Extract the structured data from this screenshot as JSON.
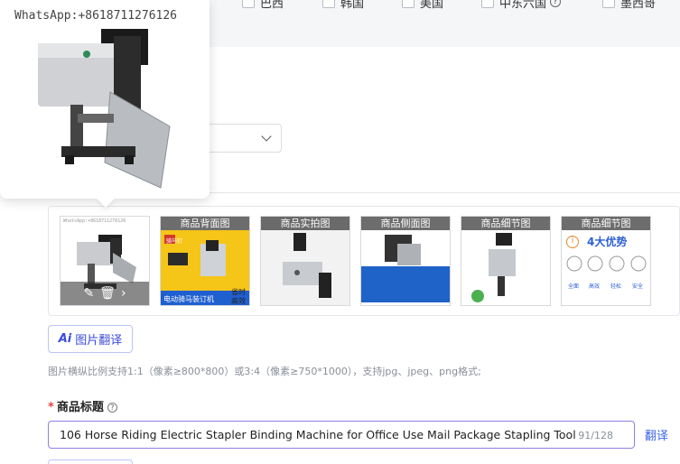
{
  "countries": [
    {
      "label": "巴西"
    },
    {
      "label": "韩国"
    },
    {
      "label": "美国"
    },
    {
      "label": "中东六国"
    },
    {
      "label": "墨西哥"
    }
  ],
  "preview": {
    "watermark": "WhatsApp:+8618711276126"
  },
  "images": {
    "main_watermark": "WhatsApp:+8618711276126",
    "thumbs": [
      {
        "label": "商品背面图",
        "caption": "电动骑马装订机",
        "badge_top": "省时",
        "badge_bottom": "高效",
        "tag": "骑马钉"
      },
      {
        "label": "商品实拍图"
      },
      {
        "label": "商品侧面图"
      },
      {
        "label": "商品细节图"
      },
      {
        "label": "商品细节图",
        "headline": "4大优势",
        "advantages": [
          "全面",
          "高效",
          "轻松",
          "安全"
        ]
      }
    ]
  },
  "ai_translate": {
    "label": "图片翻译",
    "icon": "Ai"
  },
  "hint": "图片横纵比例支持1:1（像素≥800*800）或3:4（像素≥750*1000），支持jpg、jpeg、png格式;",
  "product_title": {
    "required_mark": "*",
    "label": "商品标题",
    "value": "106 Horse Riding Electric Stapler Binding Machine for Office Use Mail Package Stapling Tool",
    "count": "91/128",
    "translate": "翻译"
  },
  "colors": {
    "accent": "#3b4bd8",
    "link": "#3b64e8",
    "input_border": "#8e80e6",
    "required": "#e54545"
  }
}
